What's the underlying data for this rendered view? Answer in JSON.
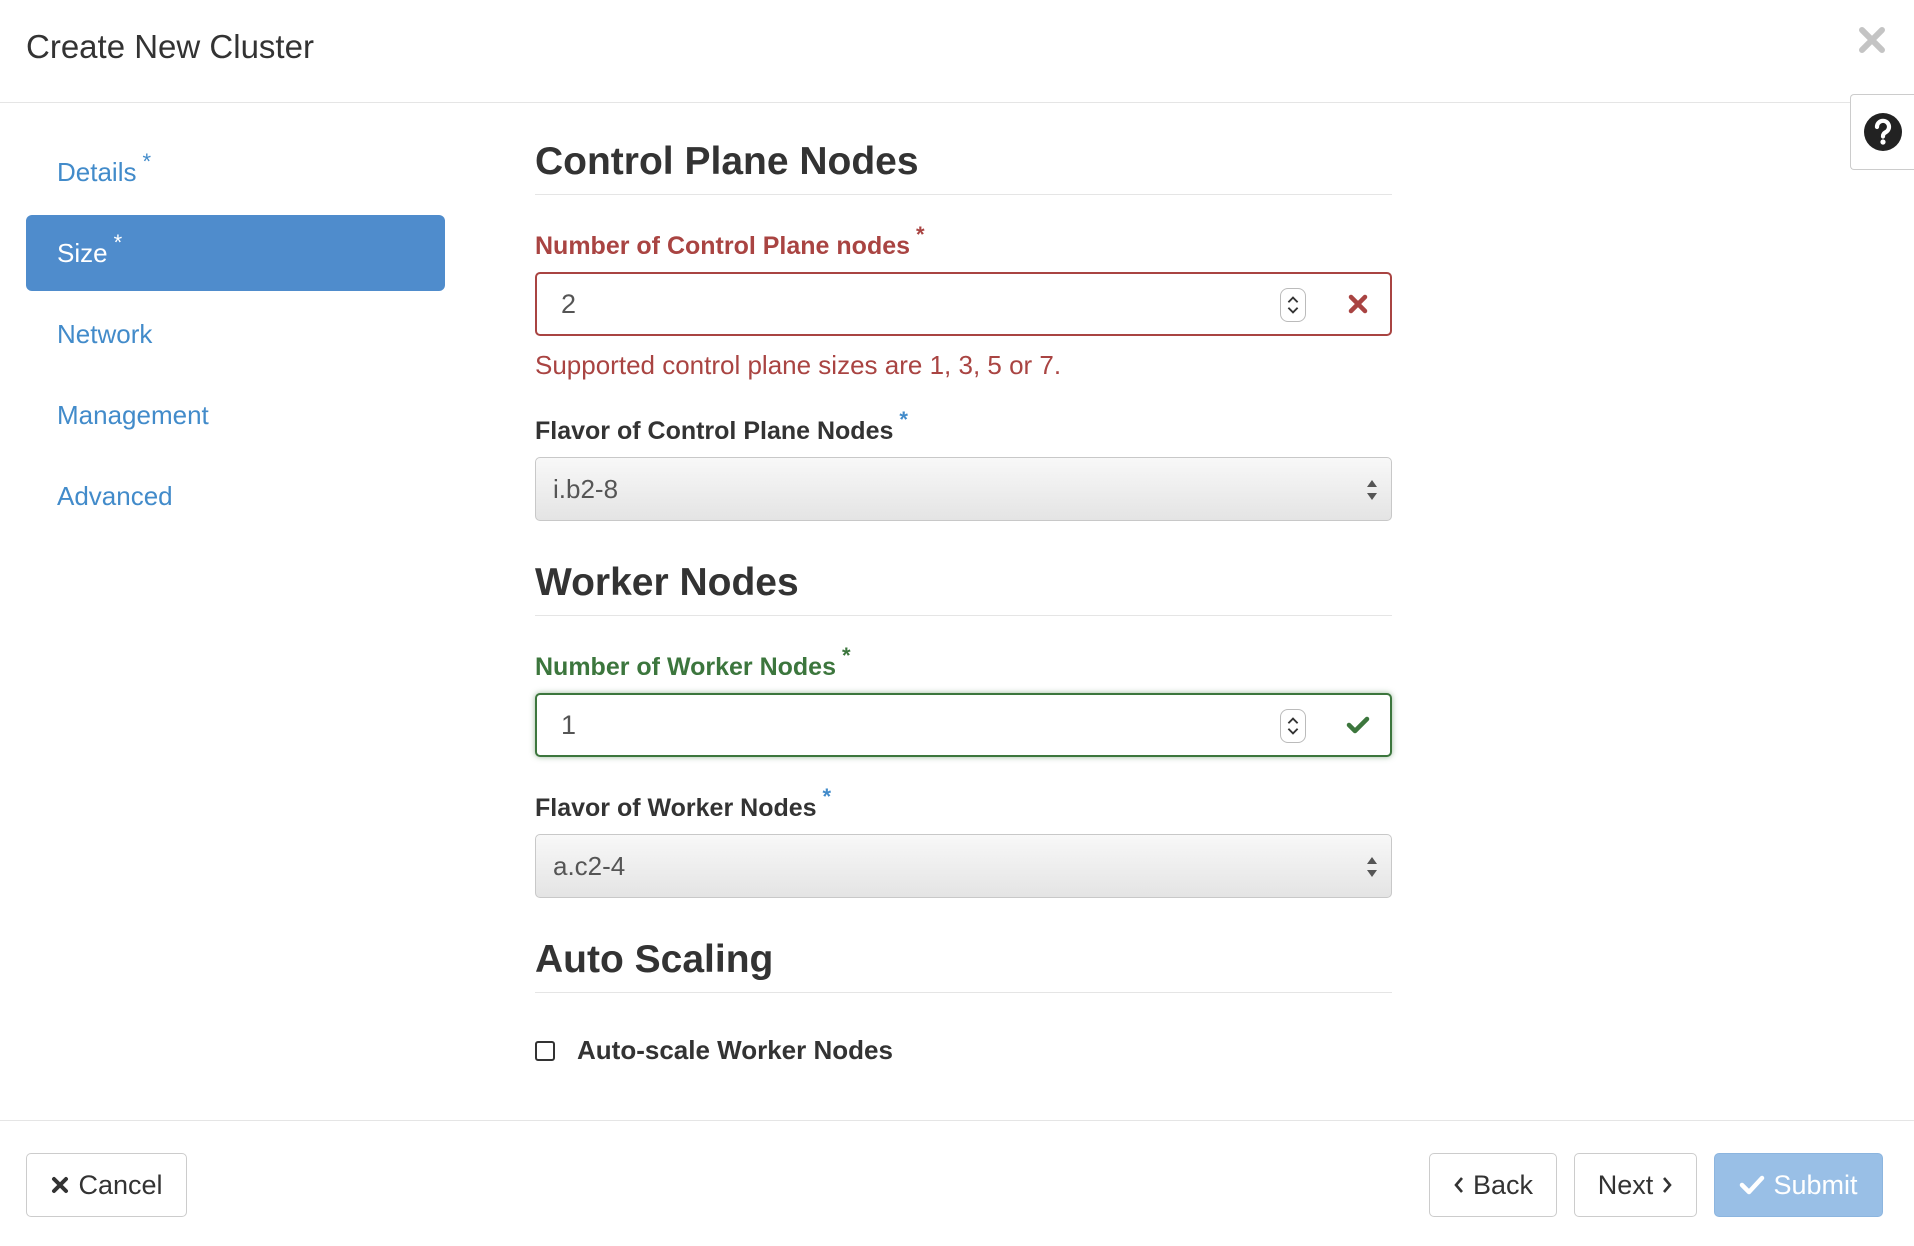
{
  "dialog": {
    "title": "Create New Cluster",
    "close_icon": "close-icon",
    "help_icon": "question-circle-icon"
  },
  "sidebar": {
    "items": [
      {
        "label": "Details",
        "required": "*"
      },
      {
        "label": "Size",
        "required": "*",
        "active": true
      },
      {
        "label": "Network"
      },
      {
        "label": "Management"
      },
      {
        "label": "Advanced"
      }
    ]
  },
  "control_plane": {
    "section_title": "Control Plane Nodes",
    "count_label": "Number of Control Plane nodes",
    "count_required": "*",
    "count_value": "2",
    "count_error": "Supported control plane sizes are 1, 3, 5 or 7.",
    "flavor_label": "Flavor of Control Plane Nodes",
    "flavor_required": "*",
    "flavor_value": "i.b2-8"
  },
  "worker": {
    "section_title": "Worker Nodes",
    "count_label": "Number of Worker Nodes",
    "count_required": "*",
    "count_value": "1",
    "flavor_label": "Flavor of Worker Nodes",
    "flavor_required": "*",
    "flavor_value": "a.c2-4"
  },
  "auto_scaling": {
    "section_title": "Auto Scaling",
    "checkbox_label": "Auto-scale Worker Nodes",
    "checked": false
  },
  "footer": {
    "cancel_label": "Cancel",
    "back_label": "Back",
    "next_label": "Next",
    "submit_label": "Submit"
  },
  "colors": {
    "link": "#428bca",
    "active_nav": "#4f8ccc",
    "error": "#a94442",
    "success": "#3c763d",
    "submit_disabled": "#99bfe6"
  }
}
